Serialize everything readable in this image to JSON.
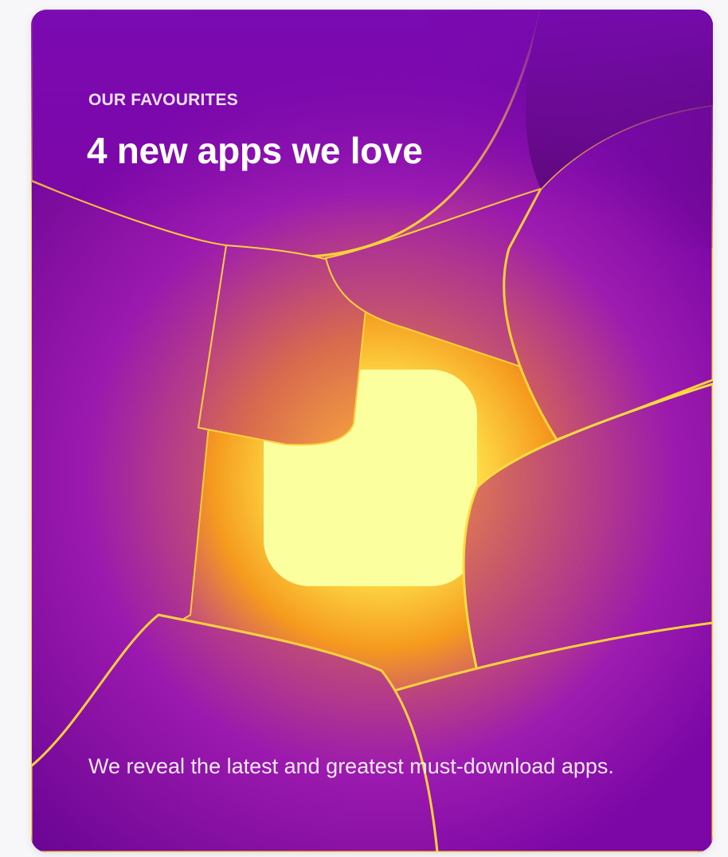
{
  "card": {
    "eyebrow": "OUR FAVOURITES",
    "title": "4 new apps we love",
    "description": "We reveal the latest and greatest must-download apps."
  },
  "artwork": {
    "subject": "abstract glowing app icon shapes",
    "colors": {
      "background": "#7a0a9e",
      "glow_center": "#fbff9a",
      "glow_mid": "#ffcc00",
      "edge_light": "#ffd23a",
      "tile_dark": "#5e0a80"
    }
  }
}
